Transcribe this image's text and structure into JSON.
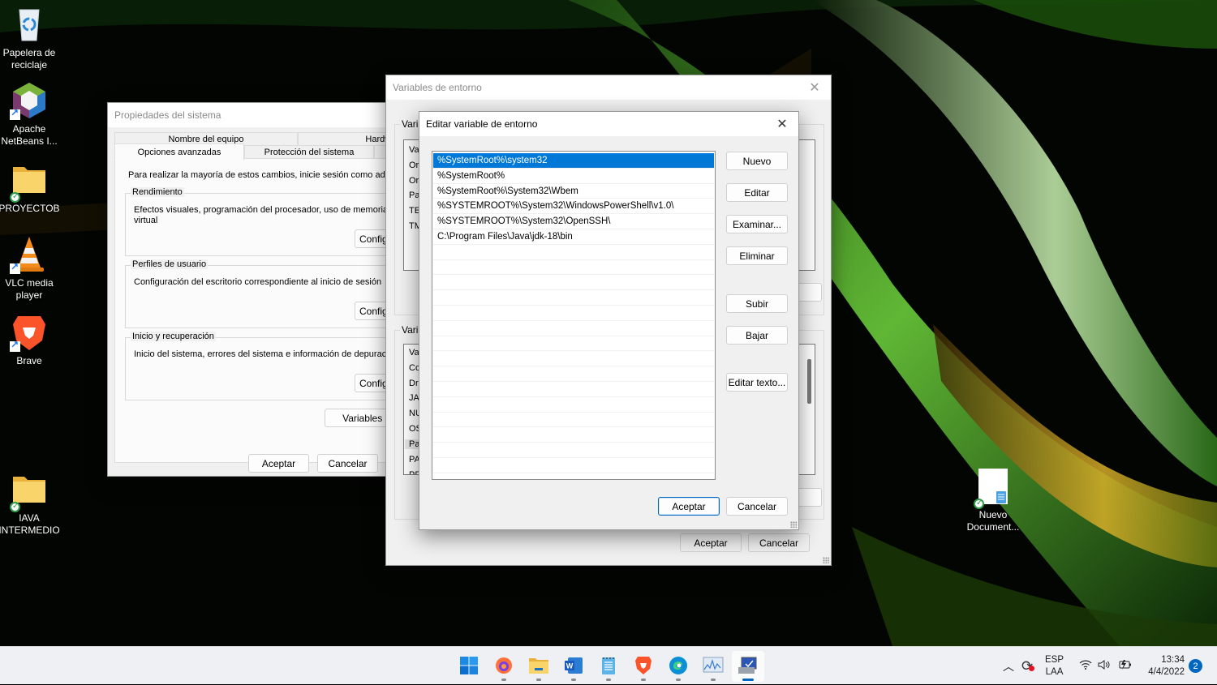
{
  "desktop": {
    "icons": [
      {
        "label": "Papelera de reciclaje",
        "icon": "recycle-bin-icon"
      },
      {
        "label": "Apache NetBeans I...",
        "icon": "netbeans-icon"
      },
      {
        "label": "PROYECTOB",
        "icon": "folder-icon"
      },
      {
        "label": "VLC media player",
        "icon": "vlc-icon"
      },
      {
        "label": "Brave",
        "icon": "brave-icon"
      },
      {
        "label": "IAVA INTERMEDIO",
        "icon": "folder-icon"
      },
      {
        "label": "Nuevo Document...",
        "icon": "text-document-icon"
      }
    ]
  },
  "system_properties": {
    "title": "Propiedades del sistema",
    "tabs_row1": [
      "Nombre del equipo",
      "Hardwar"
    ],
    "tabs_row2": [
      "Opciones avanzadas",
      "Protección del sistema"
    ],
    "active_tab": "Opciones avanzadas",
    "admin_note": "Para realizar la mayoría de estos cambios, inicie sesión como admir",
    "groups": [
      {
        "title": "Rendimiento",
        "description_line1": "Efectos visuales, programación del procesador, uso de memoria y",
        "description_line2": "virtual",
        "button": "Configu"
      },
      {
        "title": "Perfiles de usuario",
        "description_line1": "Configuración del escritorio correspondiente al inicio de sesión",
        "button": "Configu"
      },
      {
        "title": "Inicio y recuperación",
        "description_line1": "Inicio del sistema, errores del sistema e información de depuración",
        "button": "Configu"
      }
    ],
    "env_button": "Variables de",
    "ok": "Aceptar",
    "cancel": "Cancelar"
  },
  "env_variables": {
    "title": "Variables de entorno",
    "user_group_label": "Varia",
    "user_rows": [
      "Va",
      "Or",
      "Or",
      "Pa",
      "TE",
      "TM"
    ],
    "system_group_label": "Varia",
    "system_rows": [
      "Va",
      "Co",
      "Dr",
      "JA",
      "NU",
      "OS",
      "Pa",
      "PA",
      "PR"
    ],
    "ok": "Aceptar",
    "cancel": "Cancelar"
  },
  "edit_variable": {
    "title": "Editar variable de entorno",
    "paths": [
      "%SystemRoot%\\system32",
      "%SystemRoot%",
      "%SystemRoot%\\System32\\Wbem",
      "%SYSTEMROOT%\\System32\\WindowsPowerShell\\v1.0\\",
      "%SYSTEMROOT%\\System32\\OpenSSH\\",
      "C:\\Program Files\\Java\\jdk-18\\bin"
    ],
    "selected_index": 0,
    "buttons": {
      "new": "Nuevo",
      "edit": "Editar",
      "browse": "Examinar...",
      "delete": "Eliminar",
      "up": "Subir",
      "down": "Bajar",
      "edit_text": "Editar texto..."
    },
    "ok": "Aceptar",
    "cancel": "Cancelar"
  },
  "taskbar": {
    "apps": [
      {
        "name": "start",
        "icon": "windows-start-icon"
      },
      {
        "name": "firefox",
        "icon": "firefox-icon"
      },
      {
        "name": "file-explorer",
        "icon": "file-explorer-icon"
      },
      {
        "name": "word",
        "icon": "word-icon"
      },
      {
        "name": "notepad",
        "icon": "notepad-icon"
      },
      {
        "name": "brave",
        "icon": "brave-icon"
      },
      {
        "name": "edge",
        "icon": "edge-icon"
      },
      {
        "name": "resource-monitor",
        "icon": "performance-monitor-icon"
      },
      {
        "name": "system-properties",
        "icon": "system-properties-icon",
        "active": true
      }
    ],
    "tray": {
      "language_line1": "ESP",
      "language_line2": "LAA",
      "time": "13:34",
      "date": "4/4/2022",
      "notifications": "2"
    }
  },
  "colors": {
    "selection": "#0078d7",
    "accent": "#0067c0"
  }
}
